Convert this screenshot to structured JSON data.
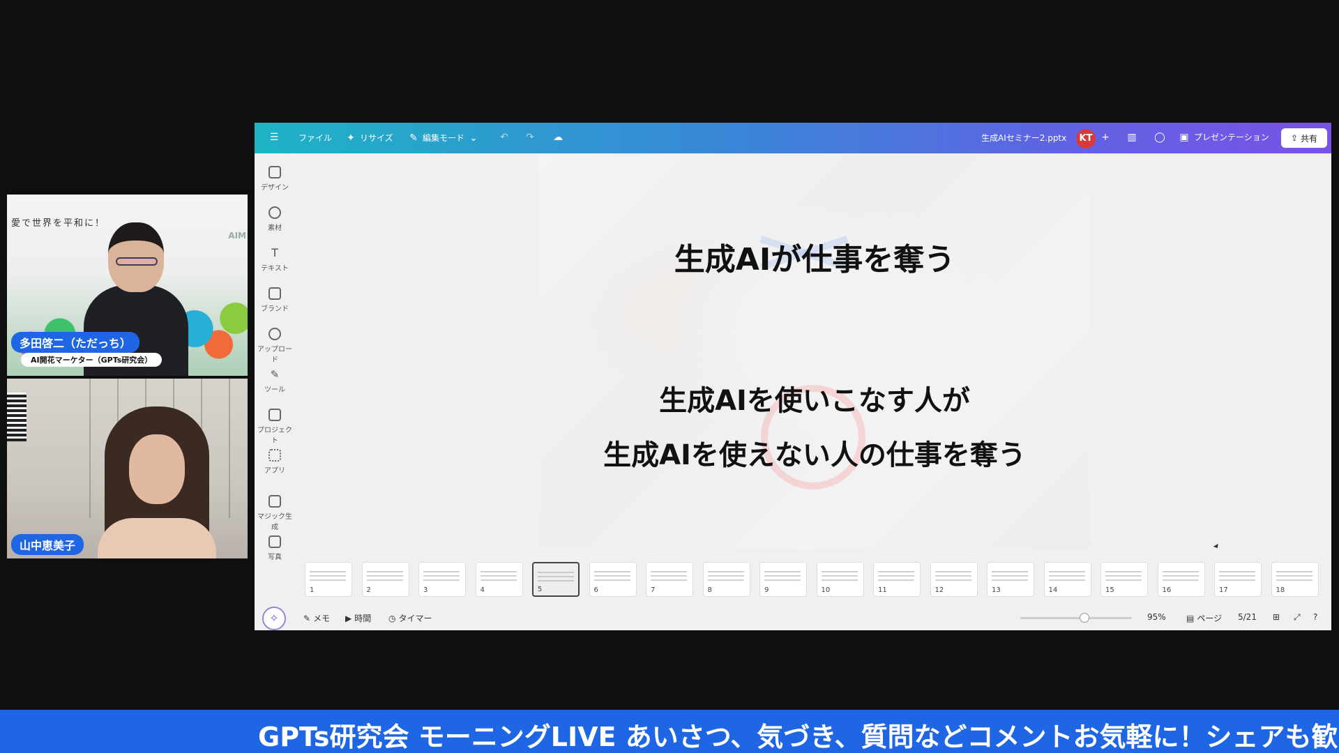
{
  "webcams": {
    "host": {
      "bg_text": "愛で世界を平和に！",
      "logo_text": "AIM",
      "name": "多田啓二（ただっち）",
      "role": "AI開花マーケター（GPTs研究会）"
    },
    "guest": {
      "name": "山中恵美子"
    }
  },
  "topbar": {
    "menu_icon": "menu-icon",
    "file": "ファイル",
    "resize": "リサイズ",
    "edit_mode": "編集モード",
    "filename": "生成AIセミナー2.pptx",
    "avatar_initials": "KT",
    "present": "プレゼンテーション",
    "share": "共有",
    "gradient": [
      "#1eb3c5",
      "#3a86d8",
      "#5f63e3",
      "#7a52e6"
    ]
  },
  "sidebar": {
    "items": [
      {
        "label": "デザイン",
        "icon": "layout-icon"
      },
      {
        "label": "素材",
        "icon": "elements-icon"
      },
      {
        "label": "テキスト",
        "icon": "text-icon"
      },
      {
        "label": "ブランド",
        "icon": "brand-icon"
      },
      {
        "label": "アップロード",
        "icon": "upload-icon"
      },
      {
        "label": "ツール",
        "icon": "draw-icon"
      },
      {
        "label": "プロジェクト",
        "icon": "folder-icon"
      },
      {
        "label": "アプリ",
        "icon": "apps-icon"
      },
      {
        "label": "マジック生成",
        "icon": "magic-icon"
      },
      {
        "label": "写真",
        "icon": "photo-icon"
      }
    ]
  },
  "slide": {
    "title": "生成AIが仕事を奪う",
    "line1": "生成AIを使いこなす人が",
    "line2": "生成AIを使えない人の仕事を奪う"
  },
  "thumbnails": [
    "1",
    "2",
    "3",
    "4",
    "5",
    "6",
    "7",
    "8",
    "9",
    "10",
    "11",
    "12",
    "13",
    "14",
    "15",
    "16",
    "17",
    "18"
  ],
  "thumbnails_active": "5",
  "bottombar": {
    "memo": "メモ",
    "time": "時間",
    "timer": "タイマー",
    "zoom": "95%",
    "pages_label": "ページ",
    "page_count": "5/21"
  },
  "ticker": {
    "text": "GPTs研究会 モーニングLIVE あいさつ、気づき、質問などコメントお気軽に！シェアも歓"
  }
}
